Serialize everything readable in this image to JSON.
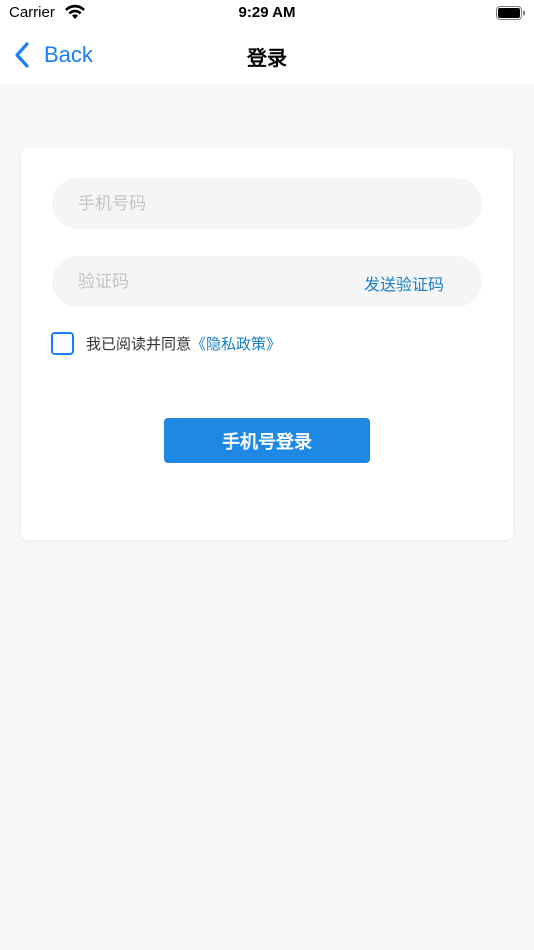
{
  "status_bar": {
    "carrier": "Carrier",
    "time": "9:29 AM",
    "icons": [
      "wifi-icon",
      "battery-icon"
    ]
  },
  "nav": {
    "back_label": "Back",
    "title": "登录",
    "back_icon": "chevron-left-icon"
  },
  "form": {
    "phone_placeholder": "手机号码",
    "phone_value": "",
    "code_placeholder": "验证码",
    "code_value": "",
    "send_code_label": "发送验证码",
    "agree_text": "我已阅读并同意",
    "policy_link": "《隐私政策》",
    "agree_checked": false,
    "login_button": "手机号登录"
  },
  "colors": {
    "accent": "#1a7ff2",
    "button": "#1e88e5",
    "background": "#f7f7f7",
    "field_bg": "#f5f5f5"
  }
}
